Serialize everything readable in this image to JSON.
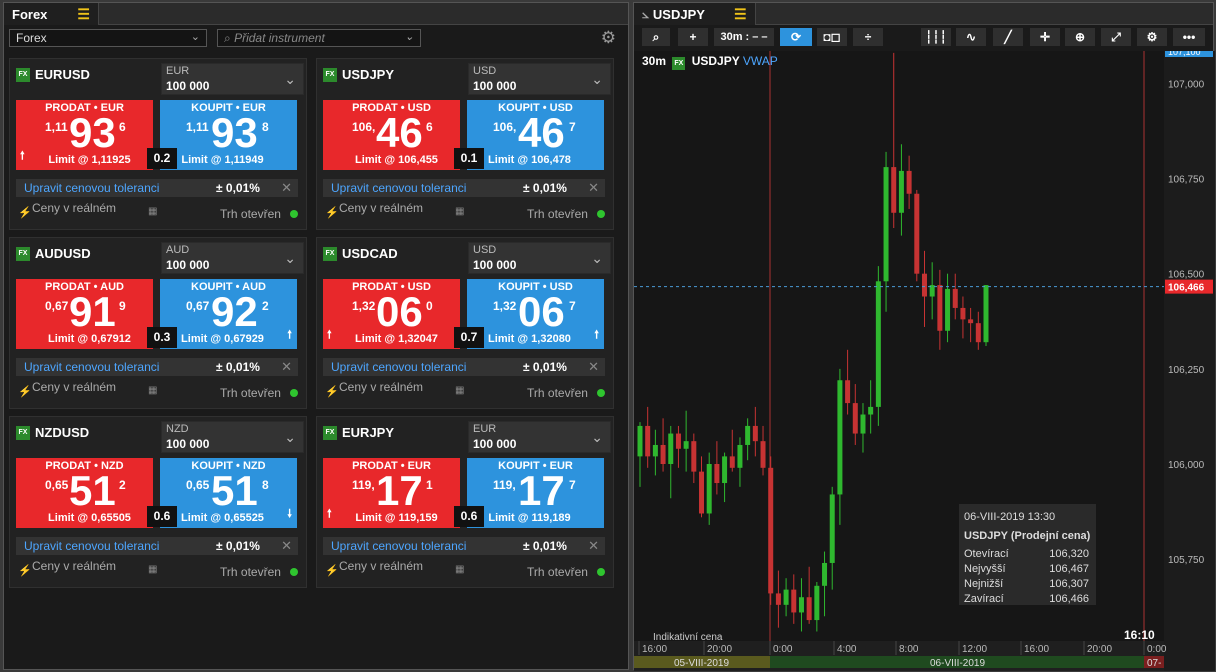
{
  "left_panel": {
    "tab_title": "Forex",
    "list_select": "Forex",
    "search_placeholder": "Přidat instrument",
    "tiles": [
      {
        "pair": "EURUSD",
        "currency": "EUR",
        "amount": "100 000",
        "sell_label": "PRODAT • EUR",
        "buy_label": "KOUPIT • EUR",
        "sell_pre": "1,11",
        "sell_big": "93",
        "sell_sup": "6",
        "buy_pre": "1,11",
        "buy_big": "93",
        "buy_sup": "8",
        "sell_limit": "Limit @ 1,11925",
        "buy_limit": "Limit @ 1,11949",
        "spread": "0.2",
        "sell_arrow": "🠕",
        "buy_arrow": ""
      },
      {
        "pair": "USDJPY",
        "currency": "USD",
        "amount": "100 000",
        "sell_label": "PRODAT • USD",
        "buy_label": "KOUPIT • USD",
        "sell_pre": "106,",
        "sell_big": "46",
        "sell_sup": "6",
        "buy_pre": "106,",
        "buy_big": "46",
        "buy_sup": "7",
        "sell_limit": "Limit @ 106,455",
        "buy_limit": "Limit @ 106,478",
        "spread": "0.1",
        "sell_arrow": "",
        "buy_arrow": ""
      },
      {
        "pair": "AUDUSD",
        "currency": "AUD",
        "amount": "100 000",
        "sell_label": "PRODAT • AUD",
        "buy_label": "KOUPIT • AUD",
        "sell_pre": "0,67",
        "sell_big": "91",
        "sell_sup": "9",
        "buy_pre": "0,67",
        "buy_big": "92",
        "buy_sup": "2",
        "sell_limit": "Limit @ 0,67912",
        "buy_limit": "Limit @ 0,67929",
        "spread": "0.3",
        "sell_arrow": "",
        "buy_arrow": "🠕"
      },
      {
        "pair": "USDCAD",
        "currency": "USD",
        "amount": "100 000",
        "sell_label": "PRODAT • USD",
        "buy_label": "KOUPIT • USD",
        "sell_pre": "1,32",
        "sell_big": "06",
        "sell_sup": "0",
        "buy_pre": "1,32",
        "buy_big": "06",
        "buy_sup": "7",
        "sell_limit": "Limit @ 1,32047",
        "buy_limit": "Limit @ 1,32080",
        "spread": "0.7",
        "sell_arrow": "🠕",
        "buy_arrow": "🠕"
      },
      {
        "pair": "NZDUSD",
        "currency": "NZD",
        "amount": "100 000",
        "sell_label": "PRODAT • NZD",
        "buy_label": "KOUPIT • NZD",
        "sell_pre": "0,65",
        "sell_big": "51",
        "sell_sup": "2",
        "buy_pre": "0,65",
        "buy_big": "51",
        "buy_sup": "8",
        "sell_limit": "Limit @ 0,65505",
        "buy_limit": "Limit @ 0,65525",
        "spread": "0.6",
        "sell_arrow": "",
        "buy_arrow": "🠗"
      },
      {
        "pair": "EURJPY",
        "currency": "EUR",
        "amount": "100 000",
        "sell_label": "PRODAT • EUR",
        "buy_label": "KOUPIT • EUR",
        "sell_pre": "119,",
        "sell_big": "17",
        "sell_sup": "1",
        "buy_pre": "119,",
        "buy_big": "17",
        "buy_sup": "7",
        "sell_limit": "Limit @ 119,159",
        "buy_limit": "Limit @ 119,189",
        "spread": "0.6",
        "sell_arrow": "🠕",
        "buy_arrow": ""
      }
    ],
    "tolerance_link": "Upravit cenovou toleranci",
    "tolerance_value": "± 0,01%",
    "realtime_label": "Ceny v reálném",
    "market_status": "Trh otevřen"
  },
  "chart_panel": {
    "tab_title": "USDJPY",
    "toolbar": {
      "interval": "30m : – –"
    },
    "legend": {
      "interval": "30m",
      "pair": "USDJPY",
      "indicator": "VWAP"
    },
    "indicative": "Indikativní cena",
    "clock": "16:10",
    "tooltip": {
      "date": "06-VIII-2019 13:30",
      "title": "USDJPY (Prodejní cena)",
      "rows": [
        {
          "k": "Otevírací",
          "v": "106,320"
        },
        {
          "k": "Nejvyšší",
          "v": "106,467"
        },
        {
          "k": "Nejnižší",
          "v": "106,307"
        },
        {
          "k": "Zavírací",
          "v": "106,466"
        }
      ]
    },
    "date_labels": {
      "prev": "05-VIII-2019",
      "cur": "06-VIII-2019",
      "next": "07-"
    }
  },
  "chart_data": {
    "type": "candlestick",
    "y_ticks": [
      "107,000",
      "106,750",
      "106,500",
      "106,250",
      "106,000",
      "105,750"
    ],
    "y_tick_values": [
      107.0,
      106.75,
      106.5,
      106.25,
      106.0,
      105.75
    ],
    "ylim": [
      105.535,
      107.085
    ],
    "top_tag": "107,100",
    "current_price": 106.466,
    "current_price_label": "106,466",
    "x_ticks": [
      "16:00",
      "20:00",
      "0:00",
      "4:00",
      "8:00",
      "12:00",
      "16:00",
      "20:00",
      "0:00"
    ],
    "candles": [
      {
        "o": 106.02,
        "h": 106.11,
        "l": 105.94,
        "c": 106.1
      },
      {
        "o": 106.1,
        "h": 106.15,
        "l": 105.99,
        "c": 106.02
      },
      {
        "o": 106.02,
        "h": 106.09,
        "l": 105.97,
        "c": 106.05
      },
      {
        "o": 106.05,
        "h": 106.12,
        "l": 105.98,
        "c": 106.0
      },
      {
        "o": 106.0,
        "h": 106.1,
        "l": 105.91,
        "c": 106.08
      },
      {
        "o": 106.08,
        "h": 106.1,
        "l": 105.99,
        "c": 106.04
      },
      {
        "o": 106.04,
        "h": 106.14,
        "l": 105.98,
        "c": 106.06
      },
      {
        "o": 106.06,
        "h": 106.08,
        "l": 105.95,
        "c": 105.98
      },
      {
        "o": 105.98,
        "h": 106.02,
        "l": 105.86,
        "c": 105.87
      },
      {
        "o": 105.87,
        "h": 106.03,
        "l": 105.84,
        "c": 106.0
      },
      {
        "o": 106.0,
        "h": 106.06,
        "l": 105.92,
        "c": 105.95
      },
      {
        "o": 105.95,
        "h": 106.03,
        "l": 105.9,
        "c": 106.02
      },
      {
        "o": 106.02,
        "h": 106.09,
        "l": 105.98,
        "c": 105.99
      },
      {
        "o": 105.99,
        "h": 106.07,
        "l": 105.94,
        "c": 106.05
      },
      {
        "o": 106.05,
        "h": 106.12,
        "l": 106.01,
        "c": 106.1
      },
      {
        "o": 106.1,
        "h": 106.15,
        "l": 106.02,
        "c": 106.06
      },
      {
        "o": 106.06,
        "h": 106.1,
        "l": 105.97,
        "c": 105.99
      },
      {
        "o": 105.99,
        "h": 106.02,
        "l": 105.63,
        "c": 105.66
      },
      {
        "o": 105.66,
        "h": 105.72,
        "l": 105.57,
        "c": 105.63
      },
      {
        "o": 105.63,
        "h": 105.7,
        "l": 105.6,
        "c": 105.67
      },
      {
        "o": 105.67,
        "h": 105.71,
        "l": 105.58,
        "c": 105.61
      },
      {
        "o": 105.61,
        "h": 105.7,
        "l": 105.56,
        "c": 105.65
      },
      {
        "o": 105.65,
        "h": 105.73,
        "l": 105.58,
        "c": 105.59
      },
      {
        "o": 105.59,
        "h": 105.69,
        "l": 105.56,
        "c": 105.68
      },
      {
        "o": 105.68,
        "h": 105.77,
        "l": 105.6,
        "c": 105.74
      },
      {
        "o": 105.74,
        "h": 105.94,
        "l": 105.67,
        "c": 105.92
      },
      {
        "o": 105.92,
        "h": 106.25,
        "l": 105.84,
        "c": 106.22
      },
      {
        "o": 106.22,
        "h": 106.3,
        "l": 106.13,
        "c": 106.16
      },
      {
        "o": 106.16,
        "h": 106.21,
        "l": 106.05,
        "c": 106.08
      },
      {
        "o": 106.08,
        "h": 106.16,
        "l": 106.03,
        "c": 106.13
      },
      {
        "o": 106.13,
        "h": 106.22,
        "l": 106.08,
        "c": 106.15
      },
      {
        "o": 106.15,
        "h": 106.52,
        "l": 106.1,
        "c": 106.48
      },
      {
        "o": 106.48,
        "h": 106.82,
        "l": 106.4,
        "c": 106.78
      },
      {
        "o": 106.78,
        "h": 107.08,
        "l": 106.62,
        "c": 106.66
      },
      {
        "o": 106.66,
        "h": 106.84,
        "l": 106.6,
        "c": 106.77
      },
      {
        "o": 106.77,
        "h": 106.81,
        "l": 106.67,
        "c": 106.71
      },
      {
        "o": 106.71,
        "h": 106.72,
        "l": 106.48,
        "c": 106.5
      },
      {
        "o": 106.5,
        "h": 106.56,
        "l": 106.36,
        "c": 106.44
      },
      {
        "o": 106.44,
        "h": 106.53,
        "l": 106.38,
        "c": 106.47
      },
      {
        "o": 106.47,
        "h": 106.51,
        "l": 106.3,
        "c": 106.35
      },
      {
        "o": 106.35,
        "h": 106.5,
        "l": 106.32,
        "c": 106.46
      },
      {
        "o": 106.46,
        "h": 106.5,
        "l": 106.38,
        "c": 106.41
      },
      {
        "o": 106.41,
        "h": 106.44,
        "l": 106.33,
        "c": 106.38
      },
      {
        "o": 106.38,
        "h": 106.41,
        "l": 106.32,
        "c": 106.37
      },
      {
        "o": 106.37,
        "h": 106.4,
        "l": 106.3,
        "c": 106.32
      },
      {
        "o": 106.32,
        "h": 106.47,
        "l": 106.31,
        "c": 106.47
      }
    ]
  }
}
